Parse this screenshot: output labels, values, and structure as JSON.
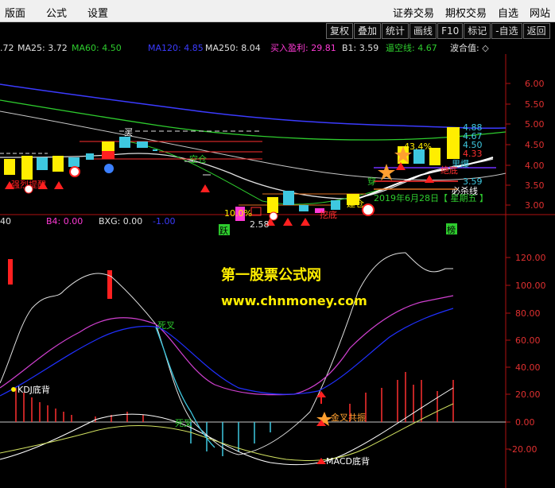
{
  "menu": {
    "left": [
      "版面",
      "公式",
      "设置"
    ],
    "right": [
      "证券交易",
      "期权交易",
      "自选",
      "网站"
    ]
  },
  "toolbar": [
    "复权",
    "叠加",
    "统计",
    "画线",
    "F10",
    "标记",
    "-自选",
    "返回"
  ],
  "ma_legend": [
    {
      "text": ".72",
      "color": "#e0e0e0"
    },
    {
      "text": "MA25: 3.72",
      "color": "#e0e0e0"
    },
    {
      "text": "MA60: 4.50",
      "color": "#2ecc2e"
    },
    {
      "text": "MA120: 4.85",
      "color": "#3b3bff"
    },
    {
      "text": "MA250: 8.04",
      "color": "#e0e0e0"
    },
    {
      "text": "买入盈利: 29.81",
      "color": "#ff3ad6"
    },
    {
      "text": "B1: 3.59",
      "color": "#e0e0e0"
    },
    {
      "text": "逼空线: 4.67",
      "color": "#2ecc2e"
    },
    {
      "text": "波合值: ◇",
      "color": "#e0e0e0"
    }
  ],
  "price_axis": [
    "6.00",
    "5.50",
    "5.00",
    "4.50",
    "4.00",
    "3.50",
    "3.00"
  ],
  "price_labels": [
    "4.88",
    "4.67",
    "4.50",
    "4.33",
    "3.59"
  ],
  "annotations": {
    "buy": "买",
    "empty_position": "空仓",
    "strong_alert": "强烈提醒",
    "wear": "穿",
    "must_kill_line": "必杀线",
    "leap": "跃",
    "low_price": "2.58",
    "pct_marker": "10.0%",
    "pct_marker2": "43.4%",
    "build_position": "建仓",
    "date_label": "2019年6月28日【 星期五 】",
    "tail": "榜",
    "surge": "里爆",
    "absolute_bottom": "绝底",
    "dig_bottom": "挖底"
  },
  "indicator_legend": [
    {
      "text": "40",
      "color": "#e0e0e0"
    },
    {
      "text": "B4: 0.00",
      "color": "#ff3ad6"
    },
    {
      "text": "BXG: 0.00",
      "color": "#e0e0e0"
    },
    {
      "text": "-1.00",
      "color": "#3b3bff"
    }
  ],
  "indicator_axis": [
    "120.00",
    "100.00",
    "80.00",
    "60.00",
    "40.00",
    "20.00",
    "0.00",
    "-20.00"
  ],
  "indicator_annotations": {
    "dead_cross_1": "死叉",
    "dead_cross_2": "死叉",
    "kdj_bottom": "KDJ底背",
    "golden_resonance": "金叉共振",
    "macd_bottom": "MACD底背"
  },
  "watermark": {
    "title": "第一股票公式网",
    "url": "www.chnmoney.com"
  }
}
